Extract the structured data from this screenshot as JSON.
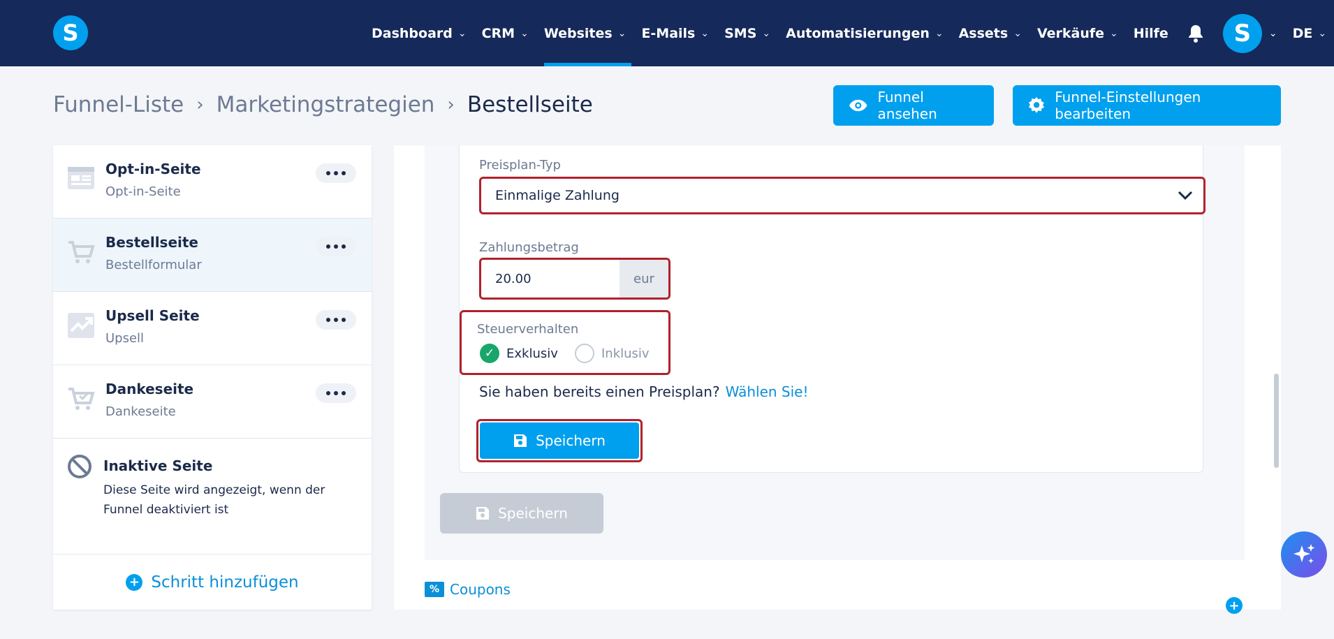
{
  "nav": {
    "items": [
      {
        "label": "Dashboard",
        "active": false
      },
      {
        "label": "CRM",
        "active": false
      },
      {
        "label": "Websites",
        "active": true
      },
      {
        "label": "E-Mails",
        "active": false
      },
      {
        "label": "SMS",
        "active": false
      },
      {
        "label": "Automatisierungen",
        "active": false
      },
      {
        "label": "Assets",
        "active": false
      },
      {
        "label": "Verkäufe",
        "active": false
      }
    ],
    "help": "Hilfe",
    "logo_letter": "S",
    "avatar_letter": "S",
    "language": "DE",
    "accent_color": "#00a0ee",
    "bg_color": "#15295a"
  },
  "breadcrumb": {
    "items": [
      "Funnel-Liste",
      "Marketingstrategien"
    ],
    "current": "Bestellseite"
  },
  "header_buttons": {
    "view": "Funnel ansehen",
    "settings": "Funnel-Einstellungen bearbeiten"
  },
  "sidebar": {
    "steps": [
      {
        "title": "Opt-in-Seite",
        "subtitle": "Opt-in-Seite",
        "icon": "optin-page-icon",
        "active": false
      },
      {
        "title": "Bestellseite",
        "subtitle": "Bestellformular",
        "icon": "cart-icon",
        "active": true
      },
      {
        "title": "Upsell Seite",
        "subtitle": "Upsell",
        "icon": "upsell-chart-icon",
        "active": false
      },
      {
        "title": "Dankeseite",
        "subtitle": "Dankeseite",
        "icon": "cart-check-icon",
        "active": false
      }
    ],
    "inactive": {
      "title": "Inaktive Seite",
      "description": "Diese Seite wird angezeigt, wenn der Funnel deaktiviert ist"
    },
    "add_step": "Schritt hinzufügen"
  },
  "form": {
    "plan_type_label": "Preisplan-Typ",
    "plan_type_value": "Einmalige Zahlung",
    "amount_label": "Zahlungsbetrag",
    "amount_value": "20.00",
    "currency": "eur",
    "tax_label": "Steuerverhalten",
    "tax_options": [
      "Exklusiv",
      "Inklusiv"
    ],
    "tax_selected": "Exklusiv",
    "existing_plan_text": "Sie haben bereits einen Preisplan?",
    "existing_plan_link": "Wählen Sie!",
    "save_label": "Speichern"
  },
  "outer_save_label": "Speichern",
  "coupons_label": "Coupons",
  "highlight_color": "#b0222b"
}
